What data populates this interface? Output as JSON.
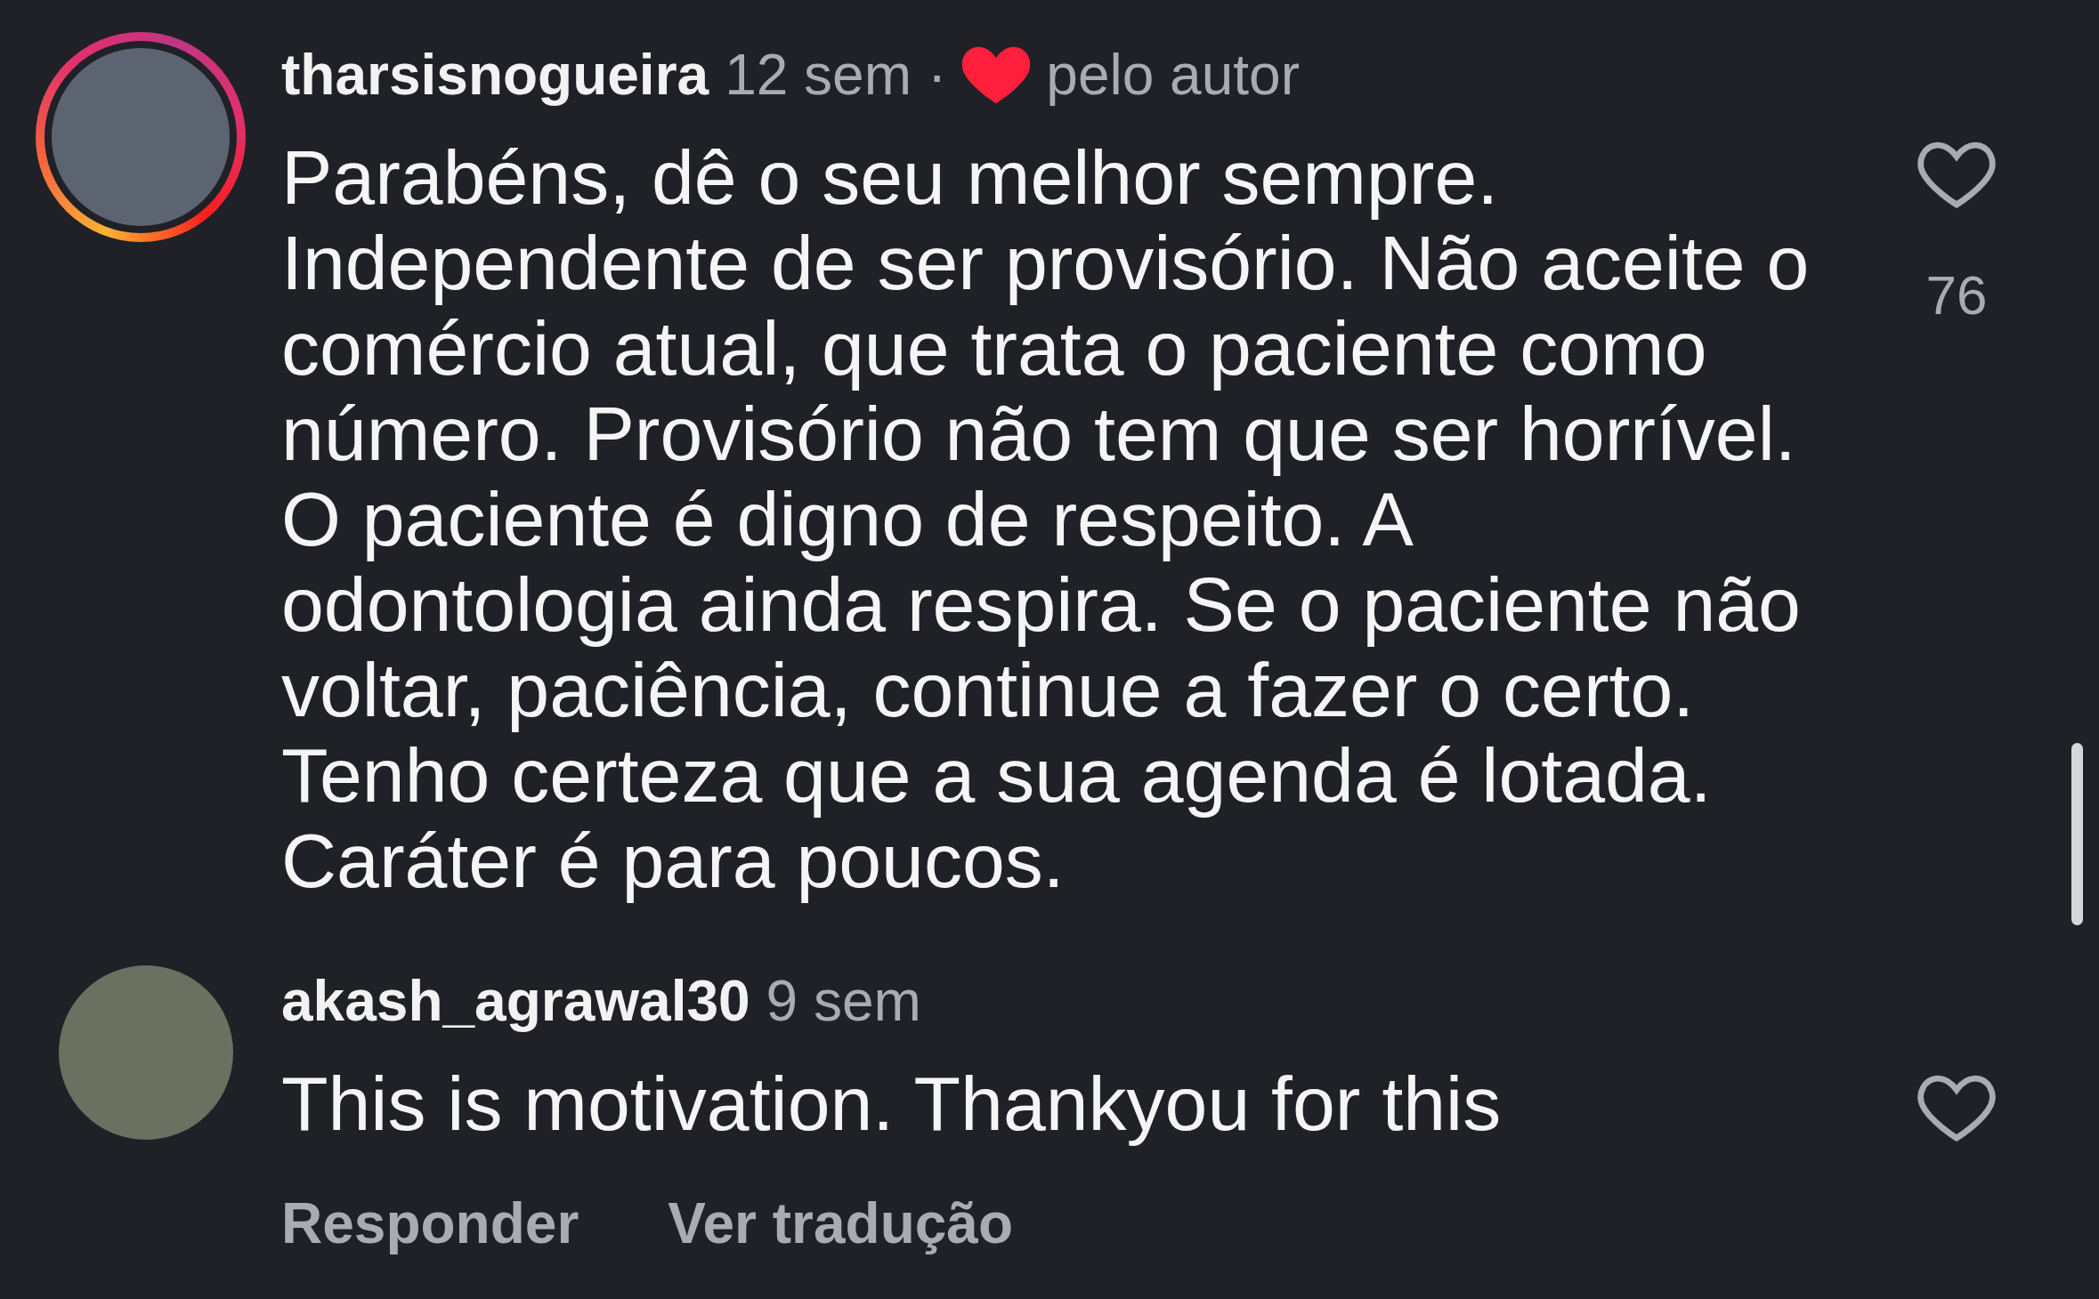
{
  "comments": [
    {
      "username": "tharsisnogueira",
      "time": "12 sem",
      "separator": "·",
      "liked_by_author": true,
      "author_label": "pelo autor",
      "text": "Parabéns, dê o seu melhor sempre. Independente de ser provisório. Não aceite o comércio atual, que trata o paciente como número. Provisório não tem que ser horrível. O paciente é digno de respeito. A odontologia ainda respira. Se o paciente não voltar, paciência, continue a fazer o certo. Tenho certeza que a sua agenda é lotada. Caráter é para poucos.",
      "likes": "76",
      "story_ring": true
    },
    {
      "username": "akash_agrawal30",
      "time": "9 sem",
      "text": "This is motivation. Thankyou for this"
    }
  ],
  "actions": [
    {
      "label": "Responder"
    },
    {
      "label": "Ver tradução"
    }
  ]
}
